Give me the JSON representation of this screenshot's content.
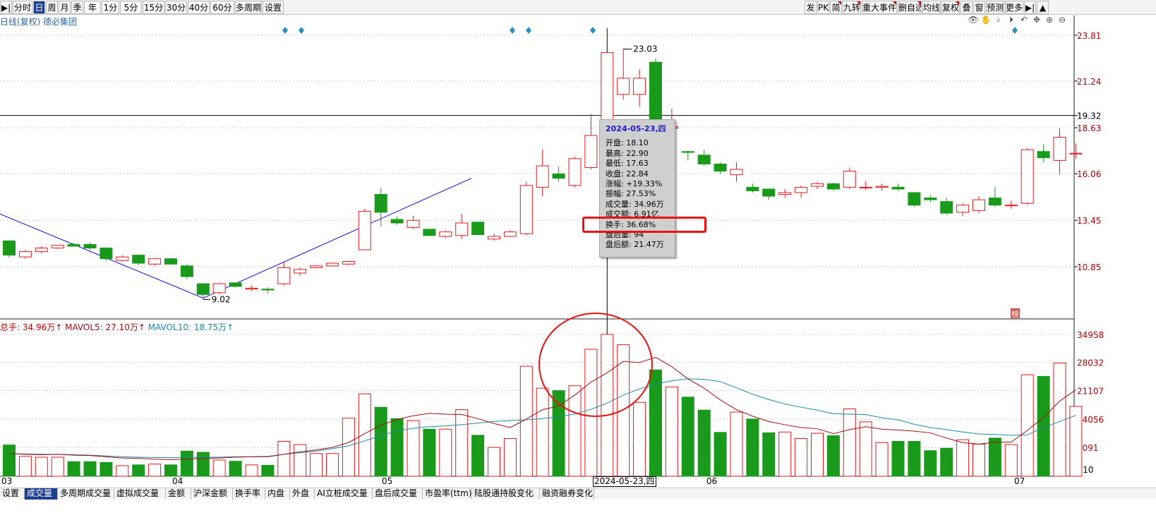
{
  "toolbar": {
    "left": [
      {
        "id": "nav",
        "label": "▶|"
      },
      {
        "id": "fenshi",
        "label": "分时"
      },
      {
        "id": "ri",
        "label": "日",
        "active": true
      },
      {
        "id": "zhou",
        "label": "周"
      },
      {
        "id": "yue",
        "label": "月"
      },
      {
        "id": "ji",
        "label": "季"
      },
      {
        "id": "nian",
        "label": "年"
      },
      {
        "id": "1fen",
        "label": "1分"
      },
      {
        "id": "5fen",
        "label": "5分"
      },
      {
        "id": "15fen",
        "label": "15分"
      },
      {
        "id": "30fen",
        "label": "30分"
      },
      {
        "id": "40fen",
        "label": "40分"
      },
      {
        "id": "60fen",
        "label": "60分"
      },
      {
        "id": "duozhouqi",
        "label": "多周期"
      },
      {
        "id": "shezhi",
        "label": "设置"
      }
    ],
    "right": [
      {
        "id": "fa",
        "label": "发"
      },
      {
        "id": "pk",
        "label": "PK"
      },
      {
        "id": "jian",
        "label": "简"
      },
      {
        "id": "jiuzhuan",
        "label": "九转"
      },
      {
        "id": "zhongda",
        "label": "重大事件"
      },
      {
        "id": "zixuan",
        "label": "删自选"
      },
      {
        "id": "junxian",
        "label": "均线"
      },
      {
        "id": "fuquan",
        "label": "复权"
      },
      {
        "id": "die",
        "label": "叠"
      },
      {
        "id": "chuang",
        "label": "窗"
      },
      {
        "id": "yuce",
        "label": "预测"
      },
      {
        "id": "gengduo",
        "label": "更多"
      },
      {
        "id": "arrow",
        "label": "▶|"
      },
      {
        "id": "up",
        "label": "▲"
      }
    ]
  },
  "chart_title": "日线(复权) 德必集团",
  "chart_icons": [
    "eye-icon",
    "hand-icon",
    "search-icon",
    "play-icon",
    "undo-icon",
    "cross-icon",
    "zoom-in-icon",
    "zoom-out-icon"
  ],
  "price_axis": [
    "23.81",
    "21.24",
    "19.32",
    "18.63",
    "16.06",
    "13.45",
    "10.85"
  ],
  "volume_axis": [
    "34958",
    "28032",
    "21107",
    "14056",
    "7091",
    "X10"
  ],
  "volume_legend": {
    "zongshou": "总手: 34.96万↑",
    "mavol5": "MAVOL5: 27.10万↑",
    "mavol10": "MAVOL10: 18.75万↑"
  },
  "annotations": {
    "high": "23.03",
    "low": "9.02"
  },
  "tooltip": {
    "date": "2024-05-23,四",
    "rows": [
      "开盘: 18.10",
      "最高: 22.90",
      "最低: 17.63",
      "收盘: 22.84",
      "涨幅: +19.33%",
      "振幅: 27.53%",
      "成交量: 34.96万",
      "成交额: 6.91亿",
      "换手: 36.68%",
      "盘后量: 94",
      "盘后额: 21.47万"
    ]
  },
  "x_labels": [
    {
      "text": "03"
    },
    {
      "text": "04"
    },
    {
      "text": "05"
    },
    {
      "text": "2024-05-23,四",
      "selected": true
    },
    {
      "text": "06"
    },
    {
      "text": "07"
    }
  ],
  "bottom_tabs": [
    "设置",
    "成交量",
    "多周期成交量",
    "虚拟成交量",
    "金额",
    "沪深金额",
    "换手率",
    "内盘",
    "外盘",
    "AI立桩成交量",
    "盘后成交量",
    "市盈率(ttm)",
    "陆股通持股变化",
    "融资融券变化"
  ],
  "badge": "榜",
  "colors": {
    "up": "#e8191b",
    "down": "#1a9a1a",
    "ma5": "#a01010",
    "ma10": "#1a8aa8",
    "trend": "#1010e0",
    "accent": "#1f3f8f"
  },
  "chart_data": {
    "type": "candlestick",
    "ylim": [
      8.8,
      24.2
    ],
    "vol_ylim": [
      0,
      36500
    ],
    "candles": [
      [
        12.3,
        12.3,
        11.35,
        11.5,
        7700
      ],
      [
        11.4,
        11.8,
        11.3,
        11.7,
        4900
      ],
      [
        11.7,
        12.0,
        11.6,
        11.9,
        4700
      ],
      [
        11.9,
        12.05,
        11.85,
        12.05,
        4700
      ],
      [
        12.1,
        12.2,
        12.0,
        12.0,
        3600
      ],
      [
        12.1,
        12.2,
        11.8,
        11.9,
        3600
      ],
      [
        11.9,
        11.95,
        11.2,
        11.3,
        3400
      ],
      [
        11.2,
        11.5,
        11.15,
        11.4,
        2600
      ],
      [
        11.5,
        11.55,
        10.95,
        11.05,
        2800
      ],
      [
        11.0,
        11.35,
        10.9,
        11.3,
        3000
      ],
      [
        11.3,
        11.35,
        10.95,
        11.0,
        2800
      ],
      [
        10.9,
        11.0,
        10.15,
        10.3,
        6200
      ],
      [
        9.9,
        9.95,
        9.02,
        9.3,
        5900
      ],
      [
        9.4,
        9.95,
        9.3,
        9.9,
        4000
      ],
      [
        9.95,
        9.95,
        9.7,
        9.75,
        3700
      ],
      [
        9.6,
        9.8,
        9.5,
        9.65,
        2800
      ],
      [
        9.6,
        9.7,
        9.35,
        9.55,
        2700
      ],
      [
        9.9,
        11.1,
        9.8,
        10.8,
        8600
      ],
      [
        10.5,
        10.8,
        10.35,
        10.7,
        7800
      ],
      [
        10.8,
        10.95,
        10.75,
        10.9,
        5600
      ],
      [
        10.9,
        11.05,
        10.85,
        11.05,
        5600
      ],
      [
        11.0,
        11.15,
        10.95,
        11.15,
        14300
      ],
      [
        11.8,
        14.1,
        11.8,
        13.95,
        20300
      ],
      [
        14.9,
        15.25,
        13.1,
        13.9,
        17000
      ],
      [
        13.5,
        13.65,
        13.2,
        13.3,
        14200
      ],
      [
        13.05,
        13.7,
        12.95,
        13.45,
        13700
      ],
      [
        12.95,
        12.95,
        12.6,
        12.6,
        11600
      ],
      [
        12.55,
        12.9,
        12.45,
        12.8,
        11600
      ],
      [
        12.6,
        13.8,
        12.4,
        13.3,
        16400
      ],
      [
        13.35,
        13.35,
        12.6,
        12.65,
        10100
      ],
      [
        12.4,
        12.7,
        12.3,
        12.55,
        7100
      ],
      [
        12.55,
        12.9,
        12.5,
        12.8,
        9300
      ],
      [
        12.7,
        15.6,
        12.6,
        15.4,
        27100
      ],
      [
        15.3,
        17.4,
        14.8,
        16.5,
        21700
      ],
      [
        16.05,
        16.45,
        15.6,
        15.8,
        21100
      ],
      [
        15.4,
        17.0,
        15.3,
        16.9,
        22300
      ],
      [
        16.4,
        19.4,
        16.3,
        18.2,
        31300
      ],
      [
        18.1,
        22.9,
        17.63,
        22.84,
        34958
      ],
      [
        20.5,
        23.03,
        20.2,
        21.4,
        32400
      ],
      [
        20.5,
        21.9,
        19.8,
        21.4,
        18200
      ],
      [
        22.3,
        22.5,
        18.0,
        18.5,
        26200
      ],
      [
        18.6,
        19.7,
        17.8,
        18.7,
        22000
      ],
      [
        17.3,
        17.35,
        16.8,
        17.25,
        19500
      ],
      [
        17.1,
        17.4,
        16.5,
        16.6,
        16300
      ],
      [
        16.6,
        16.7,
        16.05,
        16.2,
        10800
      ],
      [
        16.0,
        16.7,
        15.6,
        16.3,
        15800
      ],
      [
        15.3,
        15.5,
        15.0,
        15.1,
        14100
      ],
      [
        15.2,
        15.2,
        14.6,
        14.8,
        10700
      ],
      [
        14.9,
        15.2,
        14.7,
        15.0,
        10900
      ],
      [
        15.0,
        15.4,
        14.7,
        15.3,
        9300
      ],
      [
        15.35,
        15.6,
        15.2,
        15.5,
        10600
      ],
      [
        15.5,
        15.55,
        15.1,
        15.2,
        10000
      ],
      [
        15.3,
        16.4,
        15.2,
        16.2,
        16600
      ],
      [
        15.3,
        15.65,
        15.15,
        15.3,
        13400
      ],
      [
        15.3,
        15.5,
        15.1,
        15.35,
        8300
      ],
      [
        15.3,
        15.5,
        15.1,
        15.2,
        8600
      ],
      [
        15.0,
        15.05,
        14.2,
        14.3,
        8600
      ],
      [
        14.7,
        14.85,
        14.45,
        14.6,
        6300
      ],
      [
        14.5,
        14.7,
        13.75,
        13.85,
        6900
      ],
      [
        13.9,
        14.4,
        13.7,
        14.3,
        9000
      ],
      [
        14.0,
        14.8,
        13.85,
        14.6,
        7900
      ],
      [
        14.7,
        15.3,
        14.2,
        14.3,
        9400
      ],
      [
        14.3,
        14.55,
        14.1,
        14.3,
        7800
      ],
      [
        14.4,
        17.5,
        14.3,
        17.4,
        25000
      ],
      [
        17.3,
        17.7,
        16.7,
        16.95,
        24600
      ],
      [
        16.8,
        18.6,
        16.0,
        18.1,
        27900
      ],
      [
        17.2,
        17.75,
        16.9,
        17.2,
        17200
      ]
    ],
    "ma5": [
      5600,
      5400,
      5300,
      5400,
      5200,
      5100,
      4800,
      4500,
      4400,
      4200,
      4100,
      4200,
      4400,
      4500,
      4700,
      4800,
      4800,
      5400,
      6000,
      6500,
      7100,
      8300,
      10500,
      12600,
      14000,
      14900,
      15500,
      15300,
      15200,
      14200,
      13000,
      12000,
      14100,
      16400,
      17300,
      20000,
      23200,
      25500,
      28300,
      28000,
      29300,
      27000,
      24000,
      21700,
      18800,
      16400,
      14800,
      13500,
      12700,
      12000,
      11700,
      10500,
      11500,
      12200,
      11600,
      11400,
      11100,
      10700,
      9400,
      8300,
      7900,
      8400,
      8400,
      11300,
      14500,
      18500,
      21300
    ],
    "ma10": [
      5600,
      5500,
      5400,
      5400,
      5300,
      5200,
      5000,
      4800,
      4700,
      4600,
      4600,
      4600,
      4700,
      4700,
      4800,
      4800,
      4900,
      5400,
      5800,
      6200,
      6800,
      7500,
      8700,
      10000,
      11200,
      11800,
      12200,
      12400,
      12700,
      13100,
      13500,
      13700,
      13900,
      14200,
      14700,
      15300,
      16500,
      18000,
      20000,
      21500,
      22700,
      23500,
      24000,
      23900,
      23300,
      21800,
      20200,
      18900,
      17800,
      17000,
      16300,
      15400,
      15300,
      15200,
      14400,
      13900,
      12800,
      12000,
      11500,
      10900,
      10400,
      10300,
      10100,
      10200,
      12000,
      13500,
      15000
    ]
  }
}
